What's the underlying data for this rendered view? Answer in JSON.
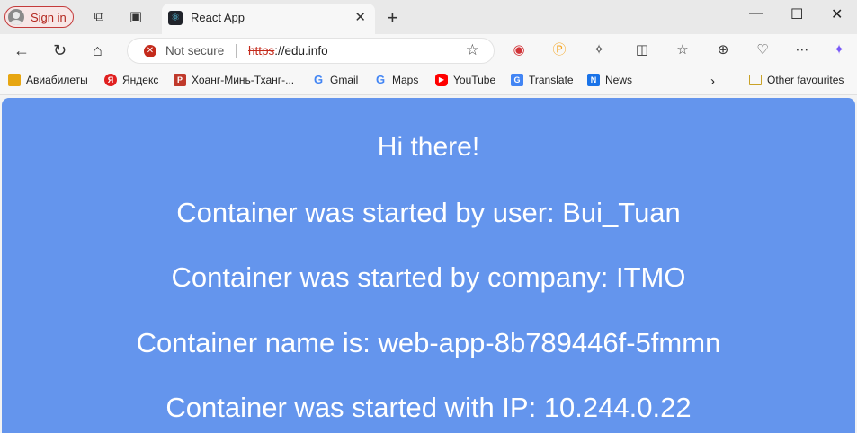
{
  "browser": {
    "sign_in_label": "Sign in",
    "tab_title": "React App",
    "address": {
      "security_label": "Not secure",
      "url_scheme": "https",
      "url_rest": "://edu.info"
    },
    "bookmarks": [
      {
        "label": "Авиабилеты",
        "icon": "aviasales-icon",
        "color": "#e7a612"
      },
      {
        "label": "Яндекс",
        "icon": "yandex-icon",
        "color": "#e02020"
      },
      {
        "label": "Хоанг-Минь-Тханг-...",
        "icon": "pdf-icon",
        "color": "#c0392b"
      },
      {
        "label": "Gmail",
        "icon": "google-icon",
        "color": "#4285f4"
      },
      {
        "label": "Maps",
        "icon": "google-icon",
        "color": "#4285f4"
      },
      {
        "label": "YouTube",
        "icon": "youtube-icon",
        "color": "#ff0000"
      },
      {
        "label": "Translate",
        "icon": "translate-icon",
        "color": "#4285f4"
      },
      {
        "label": "News",
        "icon": "news-icon",
        "color": "#1a73e8"
      }
    ],
    "other_favourites": "Other favourites"
  },
  "page": {
    "background": "#6495ed",
    "greeting": "Hi there!",
    "user_line": "Container was started by user: Bui_Tuan",
    "company_line": "Container was started by company: ITMO",
    "name_line": "Container name is: web-app-8b789446f-5fmmn",
    "ip_line": "Container was started with IP: 10.244.0.22"
  }
}
